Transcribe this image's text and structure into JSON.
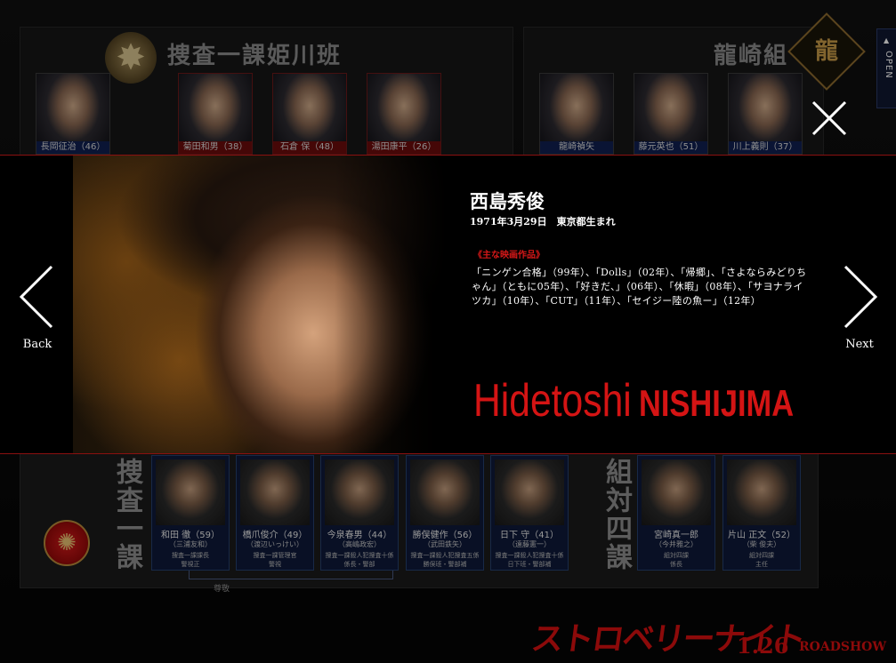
{
  "open_tab": {
    "label": "OPEN"
  },
  "sections": {
    "top_left_title": "捜査一課姫川班",
    "top_right_title": "龍崎組",
    "ryu_badge": "龍",
    "bottom_left_label": "捜査一課",
    "bottom_right_label": "組対四課"
  },
  "top_left_cast": [
    {
      "name": "長岡征治（46）",
      "highlight": false
    },
    {
      "name": "菊田和男（38）",
      "highlight": true
    },
    {
      "name": "石倉 保（48）",
      "highlight": true
    },
    {
      "name": "湯田康平（26）",
      "highlight": true
    }
  ],
  "top_right_cast": [
    {
      "name": "龍崎禎矢"
    },
    {
      "name": "藤元英也（51）"
    },
    {
      "name": "川上義則（37）"
    }
  ],
  "bottom_left_cast": [
    {
      "name": "和田 徹（59）",
      "actor": "（三浦友和）",
      "role1": "捜査一課課長",
      "role2": "警視正"
    },
    {
      "name": "橋爪俊介（49）",
      "actor": "（渡辺いっけい）",
      "role1": "捜査一課管理官",
      "role2": "警視"
    },
    {
      "name": "今泉春男（44）",
      "actor": "（高嶋政宏）",
      "role1": "捜査一課殺人犯捜査十係",
      "role2": "係長・警部"
    },
    {
      "name": "勝俣健作（56）",
      "actor": "（武田鉄矢）",
      "role1": "捜査一課殺人犯捜査五係",
      "role2": "勝俣班・警部補"
    },
    {
      "name": "日下 守（41）",
      "actor": "（遠藤憲一）",
      "role1": "捜査一課殺人犯捜査十係",
      "role2": "日下班・警部補"
    }
  ],
  "bottom_right_cast": [
    {
      "name": "宮崎真一郎",
      "actor": "（今井雅之）",
      "role1": "組対四課",
      "role2": "係長"
    },
    {
      "name": "片山 正文（52）",
      "actor": "（柴 俊夫）",
      "role1": "組対四課",
      "role2": "主任"
    }
  ],
  "connector_label": "尊敬",
  "footer": {
    "logo": "ストロベリーナイト",
    "date": "1.26",
    "roadshow": "ROADSHOW"
  },
  "modal": {
    "name_jp": "西島秀俊",
    "birth": "1971年3月29日　東京都生まれ",
    "films_heading": "《主な映画作品》",
    "films": "「ニンゲン合格」（99年）、「Dolls」（02年）、「帰郷」、「さよならみどりちゃん」（ともに05年）、「好きだ、」（06年）、「休暇」（08年）、「サヨナライツカ」（10年）、「CUT」（11年）、「セイジー陸の魚ー」（12年）",
    "name_en_first": "Hidetoshi",
    "name_en_last": "NISHIJIMA",
    "back_label": "Back",
    "next_label": "Next"
  },
  "colors": {
    "accent_red": "#d41414",
    "name_bar_blue": "#102050",
    "name_bar_red": "#6a0c0c"
  },
  "icons": {
    "back": "chevron-left-icon",
    "next": "chevron-right-icon",
    "close": "close-icon"
  }
}
